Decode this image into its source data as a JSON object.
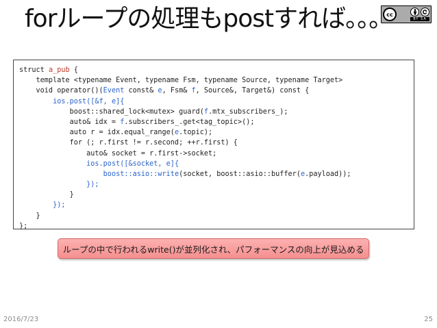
{
  "slide": {
    "title": "forループの処理もpostすれば。。。",
    "license_badge": {
      "icon_names": [
        "creative-commons-icon",
        "attribution-icon",
        "share-alike-icon"
      ],
      "badge_text": "BY SA",
      "cc_text": "cc"
    },
    "code_lines": [
      [
        {
          "t": "struct "
        },
        {
          "t": "a_pub",
          "c": "kw"
        },
        {
          "t": " {"
        }
      ],
      [
        {
          "t": "    template <typename Event, typename Fsm, typename Source, typename Target>"
        }
      ],
      [
        {
          "t": "    void operator()("
        },
        {
          "t": "Event",
          "c": "hl"
        },
        {
          "t": " const& "
        },
        {
          "t": "e",
          "c": "hl"
        },
        {
          "t": ", Fsm& "
        },
        {
          "t": "f",
          "c": "hl"
        },
        {
          "t": ", Source&, Target&) const {"
        }
      ],
      [
        {
          "t": "        "
        },
        {
          "t": "ios.post([&f, e]{",
          "c": "hl"
        }
      ],
      [
        {
          "t": "            boost::shared_lock<mutex> guard("
        },
        {
          "t": "f",
          "c": "hl"
        },
        {
          "t": ".mtx_subscribers_);"
        }
      ],
      [
        {
          "t": "            auto& idx = "
        },
        {
          "t": "f",
          "c": "hl"
        },
        {
          "t": ".subscribers_.get<tag_topic>();"
        }
      ],
      [
        {
          "t": "            auto r = idx.equal_range("
        },
        {
          "t": "e",
          "c": "hl"
        },
        {
          "t": ".topic);"
        }
      ],
      [
        {
          "t": "            for (; r.first != r.second; ++r.first) {"
        }
      ],
      [
        {
          "t": "                auto& socket = r.first->socket;"
        }
      ],
      [
        {
          "t": "                "
        },
        {
          "t": "ios.post([&socket, e]{",
          "c": "hl"
        }
      ],
      [
        {
          "t": "                    "
        },
        {
          "t": "boost::asio::write",
          "c": "hl"
        },
        {
          "t": "(socket, boost::asio::buffer("
        },
        {
          "t": "e",
          "c": "hl"
        },
        {
          "t": ".payload));"
        }
      ],
      [
        {
          "t": "                "
        },
        {
          "t": "});",
          "c": "hl"
        }
      ],
      [
        {
          "t": "            }"
        }
      ],
      [
        {
          "t": "        "
        },
        {
          "t": "});",
          "c": "hl"
        }
      ],
      [
        {
          "t": "    }"
        }
      ],
      [
        {
          "t": "};"
        }
      ]
    ],
    "callout_text": "ループの中で行われるwrite()が並列化され、パフォーマンスの向上が見込める",
    "footer_date": "2016/7/23",
    "page_number": "25",
    "colors": {
      "struct_name": "#c0392b",
      "highlight": "#2a62c9",
      "callout_bg": "#f8a3a3",
      "callout_border": "#d06a6a",
      "footer_text": "#8a8a8a"
    }
  }
}
